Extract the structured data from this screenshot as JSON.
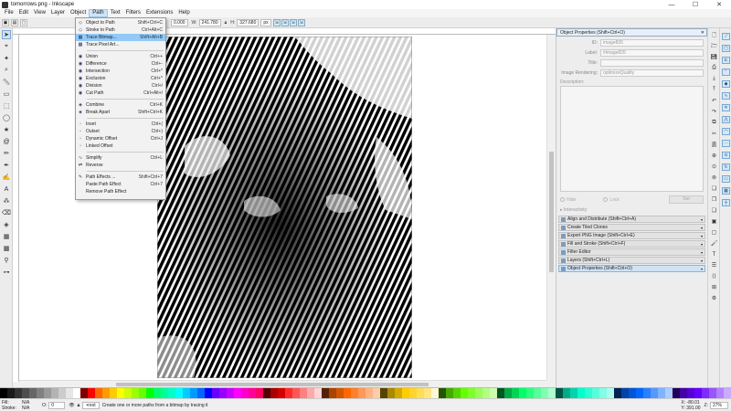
{
  "window": {
    "title": "tomorrows.png - Inkscape",
    "controls": [
      "—",
      "☐",
      "✕"
    ]
  },
  "menubar": {
    "items": [
      "File",
      "Edit",
      "View",
      "Layer",
      "Object",
      "Path",
      "Text",
      "Filters",
      "Extensions",
      "Help"
    ],
    "active": "Path"
  },
  "toolctrl": {
    "x_label": "X:",
    "x_value": "0.000",
    "y_label": "Y:",
    "y_value": "",
    "w_label": "W:",
    "w_value": "241.780",
    "lock_icon": "lock-icon",
    "h_label": "H:",
    "h_value": "327.680",
    "unit": "px"
  },
  "path_menu": {
    "items": [
      {
        "label": "Object to Path",
        "shortcut": "Shift+Ctrl+C",
        "icon": "◇"
      },
      {
        "label": "Stroke to Path",
        "shortcut": "Ctrl+Alt+C",
        "icon": "◇"
      },
      {
        "label": "Trace Bitmap...",
        "shortcut": "Shift+Alt+B",
        "icon": "▦",
        "highlighted": true
      },
      {
        "label": "Trace Pixel Art...",
        "shortcut": "",
        "icon": "▩"
      },
      {
        "sep": true
      },
      {
        "label": "Union",
        "shortcut": "Ctrl++",
        "icon": "◉"
      },
      {
        "label": "Difference",
        "shortcut": "Ctrl+-",
        "icon": "◉"
      },
      {
        "label": "Intersection",
        "shortcut": "Ctrl+*",
        "icon": "◉"
      },
      {
        "label": "Exclusion",
        "shortcut": "Ctrl+^",
        "icon": "◉"
      },
      {
        "label": "Division",
        "shortcut": "Ctrl+/",
        "icon": "◉"
      },
      {
        "label": "Cut Path",
        "shortcut": "Ctrl+Alt+/",
        "icon": "◉"
      },
      {
        "sep": true
      },
      {
        "label": "Combine",
        "shortcut": "Ctrl+K",
        "icon": "◈"
      },
      {
        "label": "Break Apart",
        "shortcut": "Shift+Ctrl+K",
        "icon": "◈"
      },
      {
        "sep": true
      },
      {
        "label": "Inset",
        "shortcut": "Ctrl+(",
        "icon": "▫"
      },
      {
        "label": "Outset",
        "shortcut": "Ctrl+)",
        "icon": "▫"
      },
      {
        "label": "Dynamic Offset",
        "shortcut": "Ctrl+J",
        "icon": "▫"
      },
      {
        "label": "Linked Offset",
        "shortcut": "",
        "icon": "▫"
      },
      {
        "sep": true
      },
      {
        "label": "Simplify",
        "shortcut": "Ctrl+L",
        "icon": "∿"
      },
      {
        "label": "Reverse",
        "shortcut": "",
        "icon": "⇄"
      },
      {
        "sep": true
      },
      {
        "label": "Path Effects ...",
        "shortcut": "Shift+Ctrl+7",
        "icon": "✎"
      },
      {
        "label": "Paste Path Effect",
        "shortcut": "Ctrl+7",
        "icon": ""
      },
      {
        "label": "Remove Path Effect",
        "shortcut": "",
        "icon": ""
      }
    ]
  },
  "object_properties": {
    "title": "Object Properties (Shift+Ctrl+O)",
    "id_label": "ID:",
    "id_value": "image826",
    "label_label": "Label:",
    "label_value": "#image826",
    "title_label": "Title:",
    "title_value": "",
    "rendering_label": "Image Rendering:",
    "rendering_value": "optimizeQuality",
    "description_label": "Description:",
    "hide_label": "Hide",
    "lock_label": "Lock",
    "set_label": "Set",
    "interactivity_label": "Interactivity"
  },
  "dock_tabs": [
    {
      "label": "Align and Distribute (Shift+Ctrl+A)",
      "active": false
    },
    {
      "label": "Create Tiled Clones",
      "active": false
    },
    {
      "label": "Export PNG Image (Shift+Ctrl+E)",
      "active": false
    },
    {
      "label": "Fill and Stroke (Shift+Ctrl+F)",
      "active": false
    },
    {
      "label": "Filter Editor",
      "active": false
    },
    {
      "label": "Layers (Shift+Ctrl+L)",
      "active": false
    },
    {
      "label": "Object Properties (Shift+Ctrl+O)",
      "active": true
    }
  ],
  "statusbar": {
    "fill_label": "Fill:",
    "fill_value": "N/A",
    "stroke_label": "Stroke:",
    "stroke_value": "N/A",
    "opacity_label": "O:",
    "opacity_value": "0",
    "layer": "•root",
    "message": "Create one or more paths from a bitmap by tracing it",
    "x_label": "X:",
    "x_value": "-80.01",
    "y_label": "Y:",
    "y_value": "391.00",
    "zoom_label": "Z:",
    "zoom_value": "27%"
  },
  "palette": [
    "#000000",
    "#1a1a1a",
    "#333333",
    "#4d4d4d",
    "#666666",
    "#808080",
    "#999999",
    "#b3b3b3",
    "#cccccc",
    "#e6e6e6",
    "#ffffff",
    "#800000",
    "#ff0000",
    "#ff6600",
    "#ff9900",
    "#ffcc00",
    "#ffff00",
    "#ccff00",
    "#99ff00",
    "#66ff00",
    "#00ff00",
    "#00ff66",
    "#00ff99",
    "#00ffcc",
    "#00ffff",
    "#00ccff",
    "#0099ff",
    "#0066ff",
    "#0000ff",
    "#6600ff",
    "#9900ff",
    "#cc00ff",
    "#ff00ff",
    "#ff00cc",
    "#ff0099",
    "#ff0066",
    "#550000",
    "#aa0000",
    "#d40000",
    "#ff2a2a",
    "#ff5555",
    "#ff8080",
    "#ffaaaa",
    "#ffd5d5",
    "#552200",
    "#aa4400",
    "#d45500",
    "#ff6600",
    "#ff7f2a",
    "#ff9955",
    "#ffb380",
    "#ffccaa",
    "#554400",
    "#aa8800",
    "#d4aa00",
    "#ffcc00",
    "#ffd42a",
    "#ffdd55",
    "#ffe680",
    "#fff6d5",
    "#225500",
    "#44aa00",
    "#55d400",
    "#66ff00",
    "#7fff2a",
    "#99ff55",
    "#b3ff80",
    "#ccffaa",
    "#005522",
    "#00aa44",
    "#00d455",
    "#00ff66",
    "#2aff80",
    "#55ff99",
    "#80ffb3",
    "#aaffcc",
    "#005544",
    "#00aa88",
    "#00d4aa",
    "#00ffcc",
    "#2affd5",
    "#55ffdd",
    "#80ffe6",
    "#aaffee",
    "#002255",
    "#0044aa",
    "#0055d4",
    "#0066ff",
    "#2a7fff",
    "#5599ff",
    "#80b3ff",
    "#aaccff",
    "#220055",
    "#4400aa",
    "#5500d4",
    "#6600ff",
    "#7f2aff",
    "#9955ff",
    "#b380ff",
    "#ccaaff"
  ]
}
